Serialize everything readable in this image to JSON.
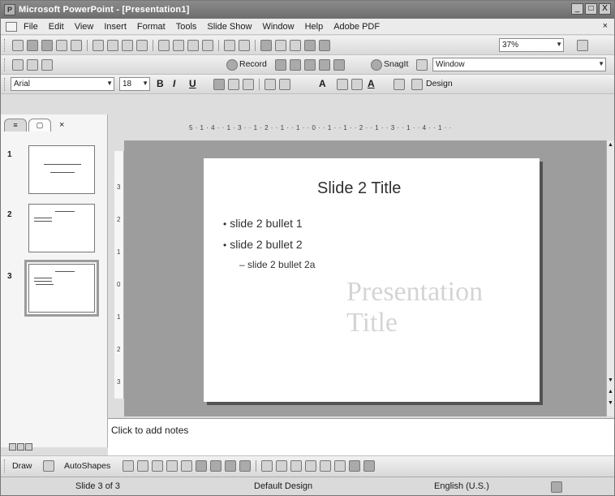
{
  "window": {
    "title": "Microsoft PowerPoint - [Presentation1]",
    "controls": [
      "_",
      "□",
      "X"
    ]
  },
  "menu": {
    "items": [
      "File",
      "Edit",
      "View",
      "Insert",
      "Format",
      "Tools",
      "Slide Show",
      "Window",
      "Help",
      "Adobe PDF"
    ],
    "close": "×"
  },
  "toolbar": {
    "zoom": "37%",
    "record_label": "Record",
    "snagit_label": "SnagIt",
    "window_label": "Window",
    "font": "Arial",
    "font_size": "18",
    "bold": "B",
    "italic": "I",
    "underline": "U",
    "grow_font": "A",
    "font_color": "A",
    "design_label": "Design"
  },
  "panel": {
    "tab1": "≡",
    "tab2": "▢",
    "close": "×",
    "thumbs": [
      {
        "number": "1"
      },
      {
        "number": "2"
      },
      {
        "number": "3"
      }
    ]
  },
  "ruler": {
    "horizontal": "5 · 1 · 4 · · 1 · 3 · · 1 · 2 · · 1 · · 1 · · 0 · · 1 · · 1 · · 2 · · 1 · · 3 · · 1 · · 4 · · 1 · ·",
    "vertical": [
      "3",
      "2",
      "1",
      "0",
      "1",
      "2",
      "3"
    ]
  },
  "slide": {
    "title": "Slide 2 Title",
    "bullets": [
      "slide 2 bullet 1",
      "slide 2 bullet 2"
    ],
    "sub_bullet": "– slide 2 bullet 2a",
    "ghost_text": "Presentation Title"
  },
  "notes": {
    "placeholder": "Click to add notes"
  },
  "drawbar": {
    "draw_label": "Draw",
    "autoshapes_label": "AutoShapes"
  },
  "status": {
    "slide": "Slide 3 of 3",
    "design": "Default Design",
    "language": "English (U.S.)"
  }
}
